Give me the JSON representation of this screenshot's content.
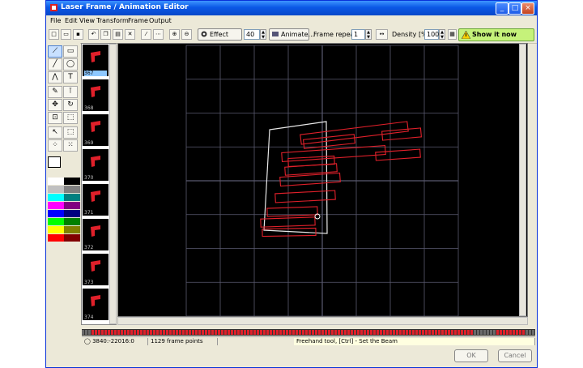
{
  "window": {
    "title": "Laser Frame / Animation Editor",
    "minimize": "_",
    "maximize": "□",
    "close": "×"
  },
  "menu": [
    "File",
    "Edit",
    "View",
    "Transform",
    "Frame",
    "Output"
  ],
  "toolbar": {
    "effect_label": "Effect",
    "effect_value": "40",
    "animate_label": "Animate...",
    "frame_repeats_label": "Frame repeats",
    "frame_repeats_value": "1",
    "density_label": "Density [%]",
    "density_value": "100",
    "show_label": "Show it now"
  },
  "palette": [
    "#ffffff",
    "#000000",
    "#c0c0c0",
    "#808080",
    "#00ffff",
    "#008080",
    "#ff00ff",
    "#800080",
    "#0000ff",
    "#000080",
    "#00ff00",
    "#008000",
    "#ffff00",
    "#808000",
    "#ff0000",
    "#800000"
  ],
  "thumbnails": [
    {
      "label": "367",
      "selected": true
    },
    {
      "label": "368",
      "selected": false
    },
    {
      "label": "369",
      "selected": false
    },
    {
      "label": "370",
      "selected": false
    },
    {
      "label": "371",
      "selected": false
    },
    {
      "label": "372",
      "selected": false
    },
    {
      "label": "373",
      "selected": false
    },
    {
      "label": "374",
      "selected": false
    }
  ],
  "status": {
    "coords": "3840:-22016:0",
    "points": "1129 frame points",
    "hint": "Freehand tool, [Ctrl] - Set the Beam"
  },
  "buttons": {
    "ok": "OK",
    "cancel": "Cancel"
  },
  "colors": {
    "beam": "#e0202a",
    "grid": "#5a5a70",
    "outline": "#e8e8e8"
  }
}
